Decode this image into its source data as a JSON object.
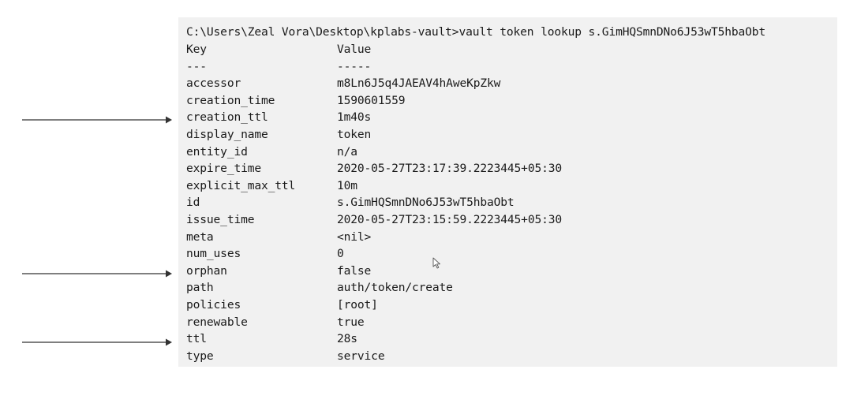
{
  "terminal": {
    "command_line": "C:\\Users\\Zeal Vora\\Desktop\\kplabs-vault>vault token lookup s.GimHQSmnDNo6J53wT5hbaObt",
    "header": {
      "key": "Key",
      "value": "Value"
    },
    "separator": {
      "key": "---",
      "value": "-----"
    },
    "rows": [
      {
        "key": "accessor",
        "value": "m8Ln6J5q4JAEAV4hAweKpZkw"
      },
      {
        "key": "creation_time",
        "value": "1590601559"
      },
      {
        "key": "creation_ttl",
        "value": "1m40s"
      },
      {
        "key": "display_name",
        "value": "token"
      },
      {
        "key": "entity_id",
        "value": "n/a"
      },
      {
        "key": "expire_time",
        "value": "2020-05-27T23:17:39.2223445+05:30"
      },
      {
        "key": "explicit_max_ttl",
        "value": "10m"
      },
      {
        "key": "id",
        "value": "s.GimHQSmnDNo6J53wT5hbaObt"
      },
      {
        "key": "issue_time",
        "value": "2020-05-27T23:15:59.2223445+05:30"
      },
      {
        "key": "meta",
        "value": "<nil>"
      },
      {
        "key": "num_uses",
        "value": "0"
      },
      {
        "key": "orphan",
        "value": "false"
      },
      {
        "key": "path",
        "value": "auth/token/create"
      },
      {
        "key": "policies",
        "value": "[root]"
      },
      {
        "key": "renewable",
        "value": "true"
      },
      {
        "key": "ttl",
        "value": "28s"
      },
      {
        "key": "type",
        "value": "service"
      }
    ]
  },
  "annotations": {
    "arrow_color": "#333333",
    "highlighted_keys": [
      "creation_ttl",
      "orphan",
      "ttl"
    ]
  },
  "colors": {
    "terminal_background": "#f1f1f1",
    "text": "#1a1a1a",
    "page_background": "#ffffff"
  },
  "pointer": {
    "icon": "mouse-pointer-icon"
  }
}
